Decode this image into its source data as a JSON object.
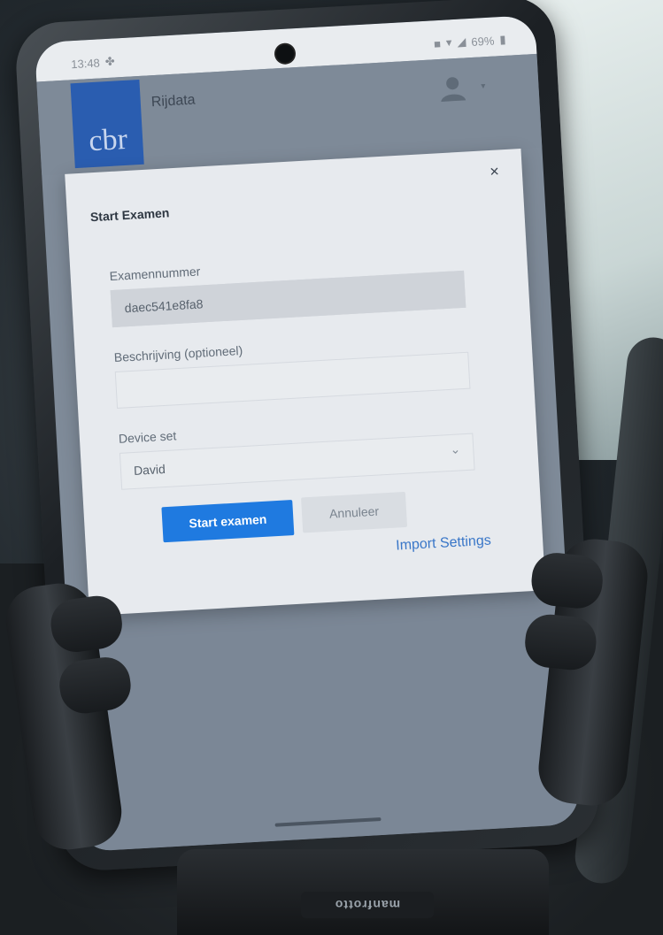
{
  "status_bar": {
    "time": "13:48",
    "battery": "69%"
  },
  "app": {
    "logo_text": "cbr",
    "title": "Rijdata"
  },
  "modal": {
    "title": "Start Examen",
    "close_glyph": "×",
    "fields": {
      "exam_number_label": "Examennummer",
      "exam_number_value": "daec541e8fa8",
      "description_label": "Beschrijving (optioneel)",
      "description_value": "",
      "device_set_label": "Device set",
      "device_set_value": "David"
    },
    "start_button": "Start examen",
    "cancel_button": "Annuleer",
    "import_link": "Import Settings"
  },
  "holder": {
    "brand": "manfrotto"
  },
  "colors": {
    "cbr_blue": "#2a5db0",
    "primary_button": "#1f7ae0",
    "link": "#3a77c8"
  },
  "icons": {
    "avatar": "user-avatar-icon",
    "close": "close-icon",
    "chevron": "chevron-down-icon"
  }
}
